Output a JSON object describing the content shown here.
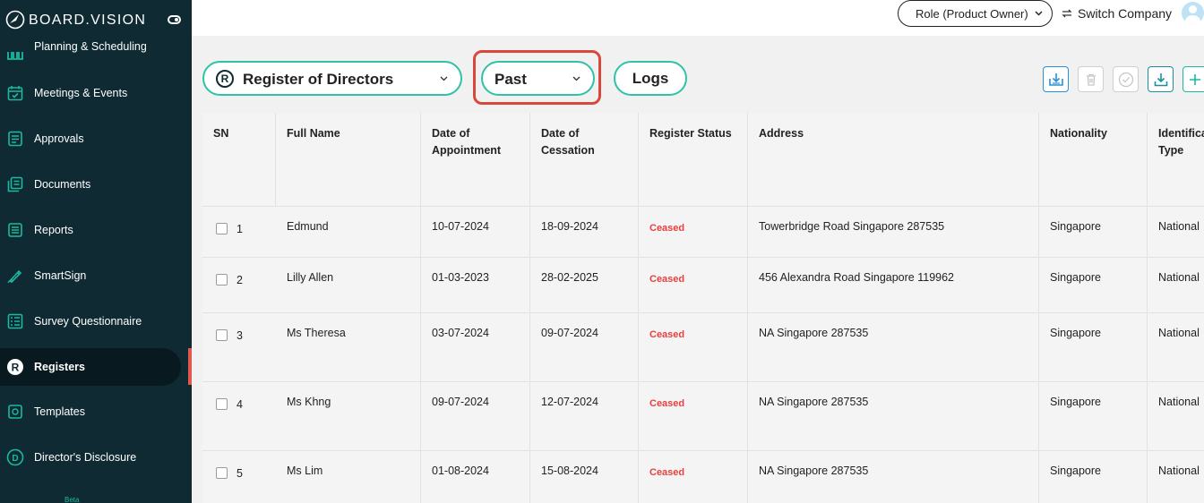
{
  "brand": {
    "name": "BOARD.VISION"
  },
  "sidebar": {
    "items": [
      {
        "label": "Planning & Scheduling",
        "icon": "calendar-bars-icon"
      },
      {
        "label": "Meetings & Events",
        "icon": "calendar-icon"
      },
      {
        "label": "Approvals",
        "icon": "approvals-icon"
      },
      {
        "label": "Documents",
        "icon": "documents-icon"
      },
      {
        "label": "Reports",
        "icon": "reports-icon"
      },
      {
        "label": "SmartSign",
        "icon": "pen-icon"
      },
      {
        "label": "Survey Questionnaire",
        "icon": "survey-icon"
      },
      {
        "label": "Registers",
        "icon": "registers-icon",
        "active": true
      },
      {
        "label": "Templates",
        "icon": "templates-icon"
      },
      {
        "label": "Director's Disclosure",
        "icon": "disclosure-icon"
      }
    ],
    "partial_item_badge": "Beta"
  },
  "header": {
    "role_label": "Role (Product Owner)",
    "switch_label": "Switch Company"
  },
  "toolbar": {
    "register_label": "Register of Directors",
    "register_icon_letter": "R",
    "filter_label": "Past",
    "logs_label": "Logs"
  },
  "colors": {
    "sidebar_bg": "#0f2a33",
    "accent": "#2fc2a6",
    "highlight": "#d9493b",
    "ceased": "#e64040"
  },
  "table": {
    "headers": {
      "sn": "SN",
      "full_name": "Full Name",
      "date_appt_1": "Date of",
      "date_appt_2": "Appointment",
      "date_cess_1": "Date of",
      "date_cess_2": "Cessation",
      "status": "Register Status",
      "address": "Address",
      "nationality": "Nationality",
      "id_type_1": "Identifica",
      "id_type_2": "Type"
    },
    "rows": [
      {
        "sn": "1",
        "name": "Edmund",
        "appointment": "10-07-2024",
        "cessation": "18-09-2024",
        "status": "Ceased",
        "address": "Towerbridge Road Singapore 287535",
        "nationality": "Singapore",
        "id_type": "National"
      },
      {
        "sn": "2",
        "name": "Lilly Allen",
        "appointment": "01-03-2023",
        "cessation": "28-02-2025",
        "status": "Ceased",
        "address": "456 Alexandra Road Singapore 119962",
        "nationality": "Singapore",
        "id_type": "National"
      },
      {
        "sn": "3",
        "name": "Ms Theresa",
        "appointment": "03-07-2024",
        "cessation": "09-07-2024",
        "status": "Ceased",
        "address": "NA Singapore 287535",
        "nationality": "Singapore",
        "id_type": "National"
      },
      {
        "sn": "4",
        "name": "Ms Khng",
        "appointment": "09-07-2024",
        "cessation": "12-07-2024",
        "status": "Ceased",
        "address": "NA Singapore 287535",
        "nationality": "Singapore",
        "id_type": "National"
      },
      {
        "sn": "5",
        "name": "Ms  Lim",
        "appointment": "01-08-2024",
        "cessation": "15-08-2024",
        "status": "Ceased",
        "address": "NA Singapore 287535",
        "nationality": "Singapore",
        "id_type": "National"
      }
    ]
  }
}
